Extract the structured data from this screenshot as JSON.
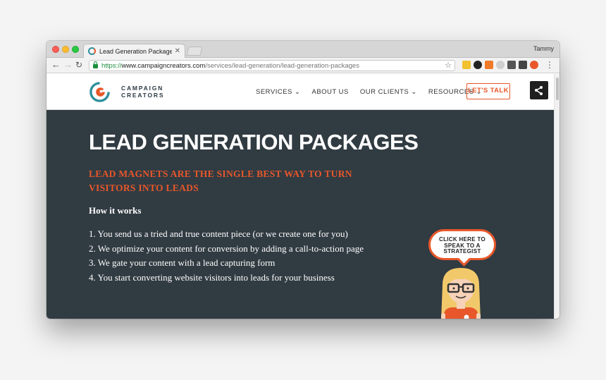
{
  "browser": {
    "tab_title": "Lead Generation Packages",
    "tab_close": "✕",
    "user_name": "Tammy",
    "url_scheme": "https://",
    "url_host": "www.campaigncreators.com",
    "url_path": "/services/lead-generation/lead-generation-packages",
    "back_icon": "←",
    "forward_icon": "→",
    "reload_icon": "↻",
    "bookmark_icon": "☆",
    "menu_icon": "⋮",
    "extension_colors": [
      "#f2c130",
      "#222222",
      "#f07a2a",
      "#cfcfcf",
      "#555555",
      "#444444",
      "#e8572a"
    ]
  },
  "site": {
    "logo_line1": "CAMPAIGN",
    "logo_line2": "CREATORS",
    "nav": [
      {
        "label": "SERVICES ⌄"
      },
      {
        "label": "ABOUT US"
      },
      {
        "label": "OUR CLIENTS ⌄"
      },
      {
        "label": "RESOURCES ⌄"
      }
    ],
    "cta_label": "LET'S TALK",
    "accent_color": "#e8572a",
    "hero_bg": "#313b42"
  },
  "hero": {
    "title": "LEAD GENERATION PACKAGES",
    "subtitle": "LEAD MAGNETS ARE THE SINGLE BEST WAY TO TURN VISITORS INTO LEADS",
    "how_heading": "How it works",
    "steps": [
      "1. You send us a tried and true content piece (or we create one for you)",
      "2. We optimize your content for conversion by adding a call-to-action page",
      "3. We gate your content with a lead capturing form",
      "4. You start converting website visitors into leads for your business"
    ],
    "bubble_line1": "CLICK HERE TO",
    "bubble_line2": "SPEAK TO A",
    "bubble_line3": "STRATEGIST"
  }
}
